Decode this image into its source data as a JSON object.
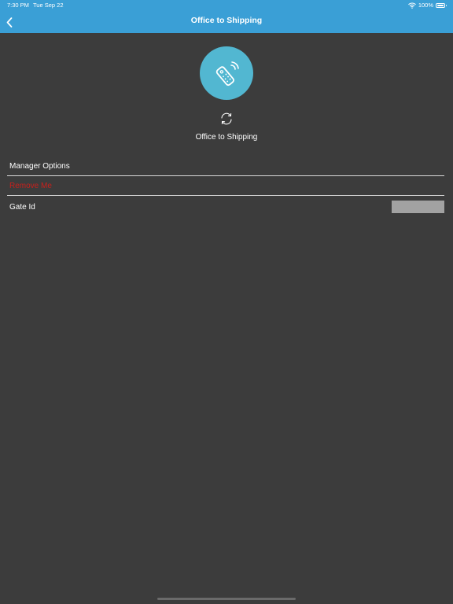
{
  "status_bar": {
    "time": "7:30 PM",
    "date": "Tue Sep 22",
    "battery": "100%",
    "wifi_icon": "wifi-icon",
    "battery_icon": "battery-icon"
  },
  "header": {
    "title": "Office to Shipping",
    "back_icon": "chevron-left-icon",
    "background": "#3a9fd6"
  },
  "device": {
    "icon": "remote-control-icon",
    "icon_background": "#52b7d1",
    "refresh_icon": "refresh-icon",
    "name": "Office to Shipping"
  },
  "manager": {
    "section_label": "Manager Options",
    "remove_label": "Remove Me",
    "remove_color": "#c8201c"
  },
  "gate": {
    "label": "Gate Id",
    "value": ""
  }
}
